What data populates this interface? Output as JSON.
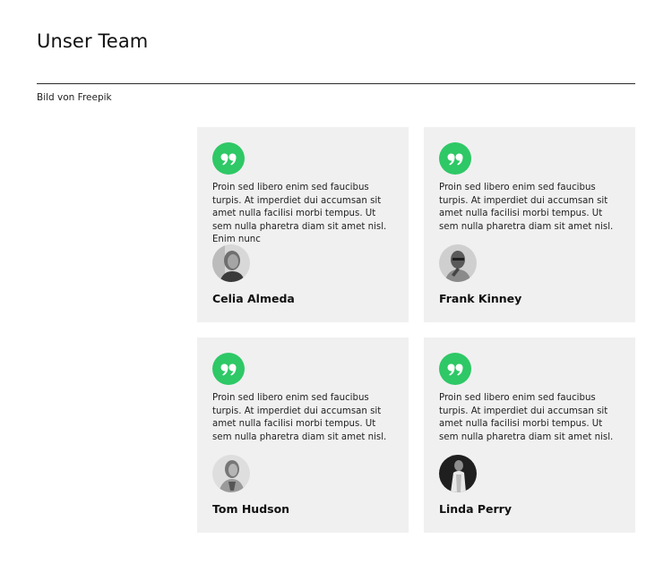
{
  "page": {
    "title": "Unser Team",
    "credit": "Bild von Freepik"
  },
  "colors": {
    "accent": "#2ec866",
    "card_background": "#f0f0f0"
  },
  "testimonials": [
    {
      "quote": "Proin sed libero enim sed faucibus turpis. At imperdiet dui accumsan sit amet nulla facilisi morbi tempus. Ut sem nulla pharetra diam sit amet nisl. Enim nunc",
      "name": "Celia Almeda",
      "icon": "quote-icon",
      "avatar": "person-photo"
    },
    {
      "quote": "Proin sed libero enim sed faucibus turpis. At imperdiet dui accumsan sit amet nulla facilisi morbi tempus. Ut sem nulla pharetra diam sit amet nisl.",
      "name": "Frank Kinney",
      "icon": "quote-icon",
      "avatar": "person-photo"
    },
    {
      "quote": "Proin sed libero enim sed faucibus turpis. At imperdiet dui accumsan sit amet nulla facilisi morbi tempus. Ut sem nulla pharetra diam sit amet nisl.",
      "name": "Tom Hudson",
      "icon": "quote-icon",
      "avatar": "person-photo"
    },
    {
      "quote": "Proin sed libero enim sed faucibus turpis. At imperdiet dui accumsan sit amet nulla facilisi morbi tempus. Ut sem nulla pharetra diam sit amet nisl.",
      "name": "Linda Perry",
      "icon": "quote-icon",
      "avatar": "person-photo"
    }
  ]
}
